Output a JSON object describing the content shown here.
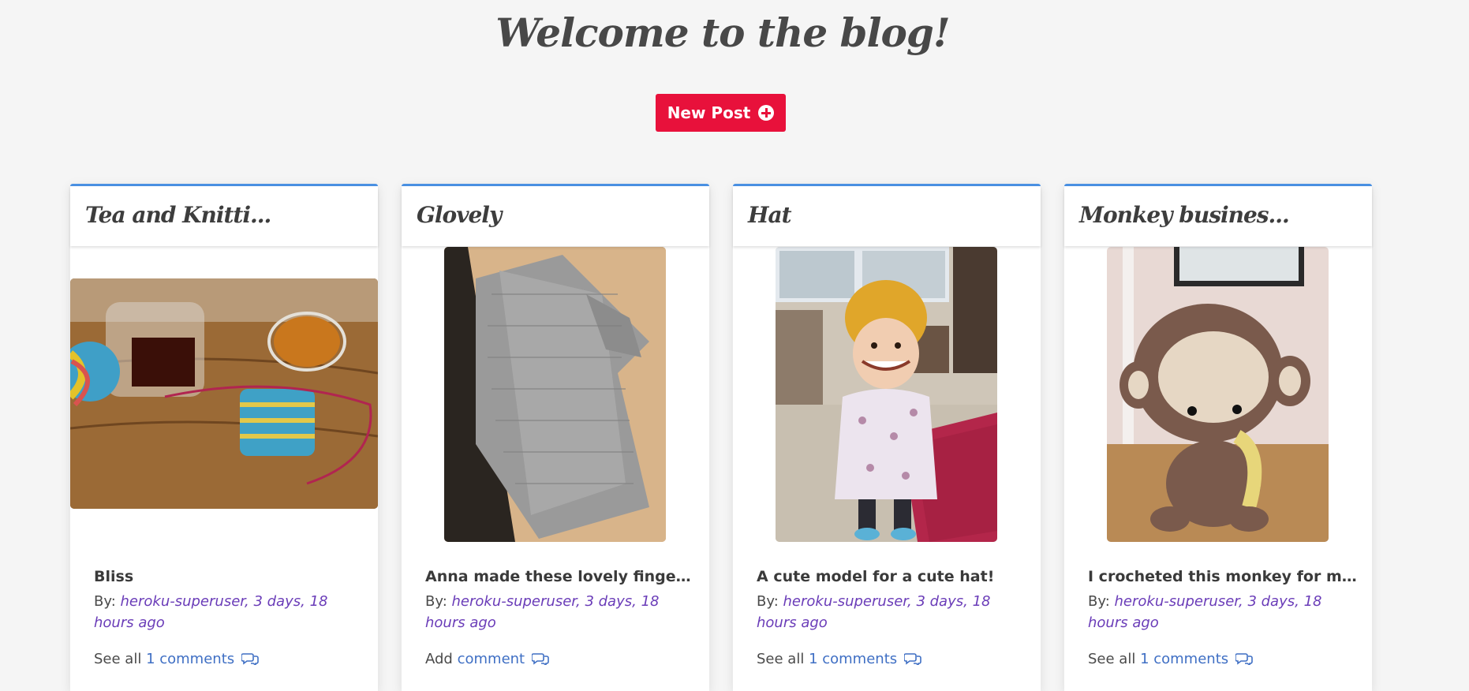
{
  "header": {
    "title": "Welcome to the blog!",
    "new_post_label": "New Post"
  },
  "colors": {
    "accent": "#e8113b",
    "card_border": "#4a90e2",
    "link": "#3f6fc4",
    "author": "#6a3cb8"
  },
  "posts": [
    {
      "title": "Tea and Knitti...",
      "excerpt": "Bliss",
      "by_label": "By:",
      "author_time": "heroku-superuser, 3 days, 18 hours ago",
      "comments_prefix": "See all",
      "comments_link": "1 comments",
      "icon": "comments-icon"
    },
    {
      "title": "Glovely",
      "excerpt": "Anna made these lovely fingerles...",
      "by_label": "By:",
      "author_time": "heroku-superuser, 3 days, 18 hours ago",
      "comments_prefix": "Add",
      "comments_link": "comment",
      "icon": "comments-icon"
    },
    {
      "title": "Hat",
      "excerpt": "A cute model for a cute hat!",
      "by_label": "By:",
      "author_time": "heroku-superuser, 3 days, 18 hours ago",
      "comments_prefix": "See all",
      "comments_link": "1 comments",
      "icon": "comments-icon"
    },
    {
      "title": "Monkey busines...",
      "excerpt": "I crocheted this monkey for my f...",
      "by_label": "By:",
      "author_time": "heroku-superuser, 3 days, 18 hours ago",
      "comments_prefix": "See all",
      "comments_link": "1 comments",
      "icon": "comments-icon"
    }
  ]
}
